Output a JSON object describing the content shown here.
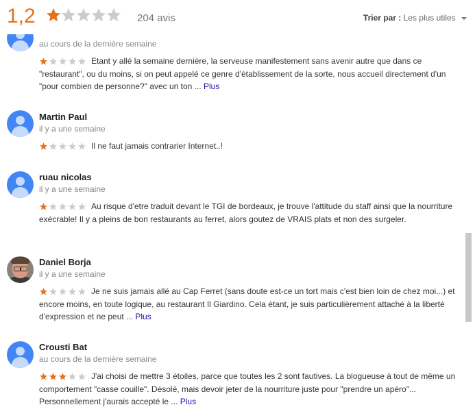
{
  "header": {
    "rating": "1,2",
    "rating_stars": 1,
    "review_count": "204 avis",
    "sort_label": "Trier par :",
    "sort_value": "Les plus utiles"
  },
  "colors": {
    "star_on": "#e7711b",
    "star_off": "#cccccc",
    "link": "#1a0dab"
  },
  "reviews": [
    {
      "name": "",
      "date": "au cours de la dernière semaine",
      "stars": 1,
      "avatar": "person-icon",
      "text": "Etant y allé la semaine dernière, la serveuse manifestement sans avenir autre que dans ce \"restaurant\", ou du moins, si on peut appelé ce genre d'établissement de la sorte, nous accueil directement d'un \"pour combien de personne?\" avec un ton ...",
      "more": "Plus"
    },
    {
      "name": "Martin Paul",
      "date": "il y a une semaine",
      "stars": 1,
      "avatar": "person-icon",
      "text": "Il ne faut jamais contrarier Internet..!",
      "more": ""
    },
    {
      "name": "ruau nicolas",
      "date": "il y a une semaine",
      "stars": 1,
      "avatar": "person-icon",
      "text": "Au risque d'etre traduit devant le TGI de bordeaux, je trouve l'attitude du staff ainsi que la nourriture exécrable! Il y a pleins de bon restaurants au ferret, alors goutez de VRAIS plats et non des surgeler.",
      "more": ""
    },
    {
      "name": "Daniel Borja",
      "date": "il y a une semaine",
      "stars": 1,
      "avatar": "profile-photo",
      "text": "Je ne suis jamais allé au Cap Ferret (sans doute est-ce un tort mais c'est bien loin de chez moi...) et encore moins, en toute logique, au restaurant Il Giardino. Cela étant, je suis particulièrement attaché à la liberté d'expression et ne peut ...",
      "more": "Plus"
    },
    {
      "name": "Crousti Bat",
      "date": "au cours de la dernière semaine",
      "stars": 3,
      "avatar": "person-icon",
      "text": "J'ai choisi de mettre 3 étoiles, parce que toutes les 2 sont fautives. La blogueuse à tout de même un comportement \"casse couille\". Désolé, mais devoir jeter de la nourriture juste pour \"prendre un apéro\"... Personnellement j'aurais accepté le ...",
      "more": "Plus"
    }
  ]
}
